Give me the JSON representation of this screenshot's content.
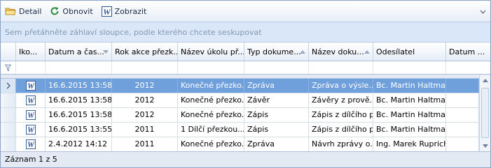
{
  "toolbar": {
    "detail_label": "Detail",
    "refresh_label": "Obnovit",
    "show_label": "Zobrazit"
  },
  "grouping_hint": "Sem přetáhněte záhlaví sloupce, podle kterého chcete seskupovat",
  "columns": [
    {
      "label": "Iko..."
    },
    {
      "label": "Datum a čas..."
    },
    {
      "label": "Rok akce přezk..."
    },
    {
      "label": "Název úkolu př..."
    },
    {
      "label": "Typ dokume..."
    },
    {
      "label": "Název doku..."
    },
    {
      "label": "Odesílatel"
    },
    {
      "label": "Datum ..."
    }
  ],
  "rows": [
    {
      "date": "16.6.2015 13:58",
      "year": "2012",
      "task": "Konečné přezko...",
      "type": "Zpráva",
      "doc": "Zpráva o výsle...",
      "sender": "Bc. Martin Haltmar",
      "date2": ""
    },
    {
      "date": "16.6.2015 13:58",
      "year": "2012",
      "task": "Konečné přezko...",
      "type": "Závěr",
      "doc": "Závěry z prově...",
      "sender": "Bc. Martin Haltmar",
      "date2": ""
    },
    {
      "date": "16.6.2015 13:58",
      "year": "2012",
      "task": "Konečné přezko...",
      "type": "Zápis",
      "doc": "Zápis z dílčího p...",
      "sender": "Bc. Martin Haltmar",
      "date2": ""
    },
    {
      "date": "16.6.2015 13:55",
      "year": "2011",
      "task": "1 Dílčí přezkou...",
      "type": "Zápis",
      "doc": "Zápis z dílčího p...",
      "sender": "Bc. Martin Haltmar",
      "date2": ""
    },
    {
      "date": "2.4.2012 14:12",
      "year": "2011",
      "task": "Konečné přezko...",
      "type": "Zpráva",
      "doc": "Návrh zprávy o...",
      "sender": "Ing. Marek Ruprich",
      "date2": ""
    }
  ],
  "footer": {
    "record_text": "Záznam 1 z 5"
  },
  "colors": {
    "selected_row": "#6fa0dc",
    "group_panel": "#d9e7f8",
    "word_icon": "#2b5797"
  }
}
